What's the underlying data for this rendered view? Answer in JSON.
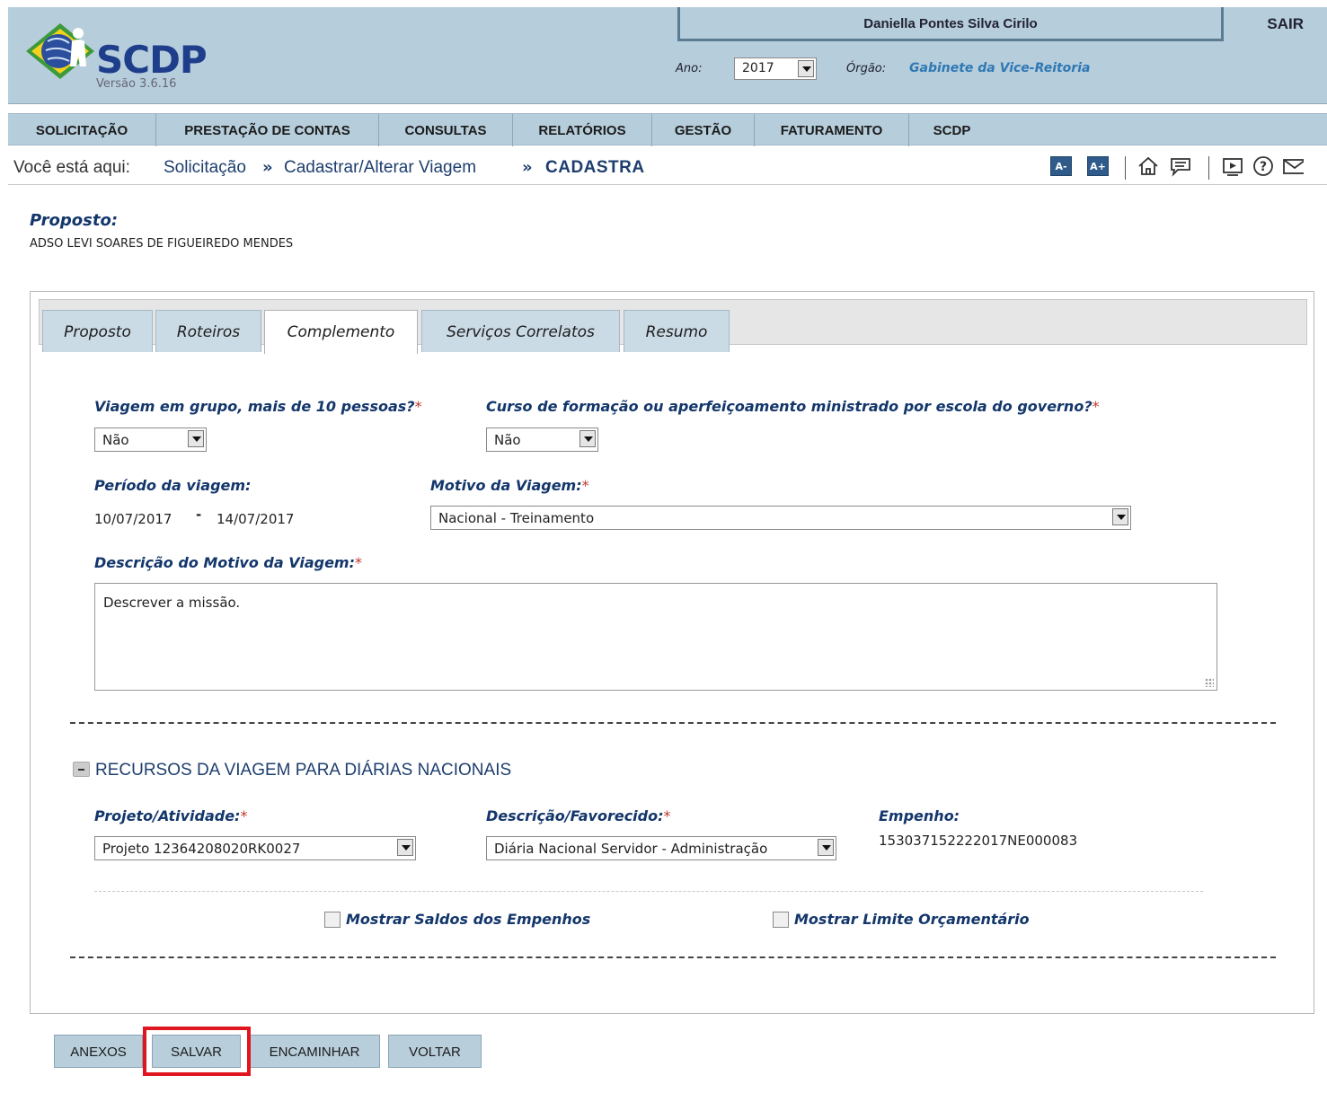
{
  "header": {
    "logo_text": "SCDP",
    "version": "Versão 3.6.16",
    "user_name": "Daniella Pontes Silva Cirilo",
    "logout_label": "SAIR",
    "ano_label": "Ano:",
    "ano_value": "2017",
    "orgao_label": "Órgão:",
    "orgao_value": "Gabinete da Vice-Reitoria"
  },
  "menu": [
    {
      "label": "SOLICITAÇÃO"
    },
    {
      "label": "PRESTAÇÃO DE CONTAS"
    },
    {
      "label": "CONSULTAS"
    },
    {
      "label": "RELATÓRIOS"
    },
    {
      "label": "GESTÃO"
    },
    {
      "label": "FATURAMENTO"
    },
    {
      "label": "SCDP"
    }
  ],
  "breadcrumb": {
    "lead": "Você está aqui:",
    "items": [
      "Solicitação",
      "Cadastrar/Alterar Viagem",
      "CADASTRA"
    ]
  },
  "toolbar": {
    "font_decrease": "A-",
    "font_increase": "A+",
    "icons": [
      "home-icon",
      "chat-icon",
      "presentation-icon",
      "help-icon",
      "mail-icon"
    ]
  },
  "proposto": {
    "label": "Proposto:",
    "name": "ADSO LEVI SOARES DE FIGUEIREDO MENDES"
  },
  "tabs": [
    {
      "label": "Proposto",
      "active": false
    },
    {
      "label": "Roteiros",
      "active": false
    },
    {
      "label": "Complemento",
      "active": true
    },
    {
      "label": "Serviços Correlatos",
      "active": false
    },
    {
      "label": "Resumo",
      "active": false
    }
  ],
  "form": {
    "grupo_label": "Viagem em grupo, mais de 10 pessoas?",
    "grupo_value": "Não",
    "curso_label": "Curso de formação ou aperfeiçoamento ministrado por escola do governo?",
    "curso_value": "Não",
    "periodo_label": "Período da viagem:",
    "periodo_inicio": "10/07/2017",
    "periodo_sep": "-",
    "periodo_fim": "14/07/2017",
    "motivo_label": "Motivo da Viagem:",
    "motivo_value": "Nacional - Treinamento",
    "descricao_label": "Descrição do Motivo da Viagem:",
    "descricao_value": "Descrever a missão.",
    "required_mark": "*"
  },
  "recursos": {
    "section_title": "RECURSOS DA VIAGEM PARA DIÁRIAS NACIONAIS",
    "projeto_label": "Projeto/Atividade:",
    "projeto_value": "Projeto 12364208020RK0027",
    "descricao_label": "Descrição/Favorecido:",
    "descricao_value": "Diária Nacional Servidor - Administração",
    "empenho_label": "Empenho:",
    "empenho_value": "153037152222017NE000083",
    "mostrar_saldos_label": "Mostrar Saldos dos Empenhos",
    "mostrar_saldos_checked": false,
    "mostrar_limite_label": "Mostrar Limite Orçamentário",
    "mostrar_limite_checked": false
  },
  "actions": {
    "anexos": "ANEXOS",
    "salvar": "SALVAR",
    "encaminhar": "ENCAMINHAR",
    "voltar": "VOLTAR"
  },
  "colors": {
    "header_bg": "#b6cddb",
    "title_blue": "#13366b",
    "highlight": "#e0161e"
  }
}
